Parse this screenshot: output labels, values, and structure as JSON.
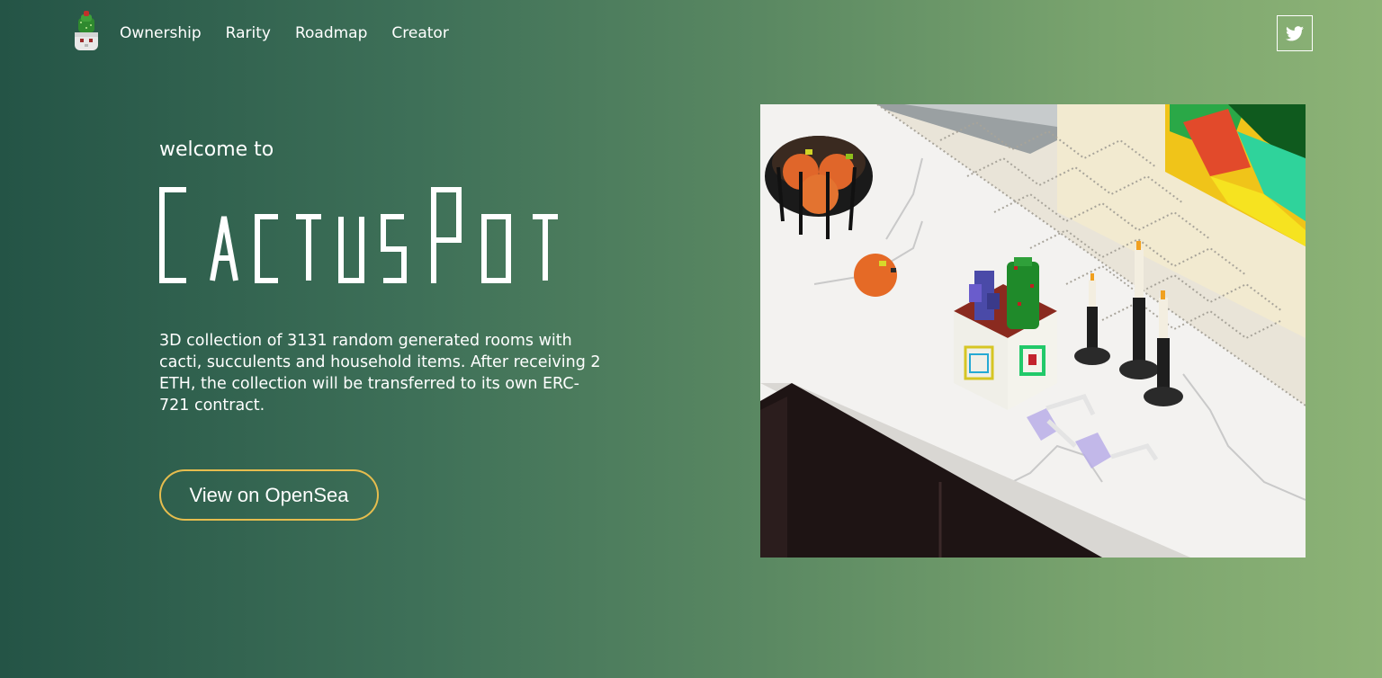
{
  "nav": {
    "logo_icon": "cactus-pot-logo-icon",
    "links": [
      {
        "label": "Ownership"
      },
      {
        "label": "Rarity"
      },
      {
        "label": "Roadmap"
      },
      {
        "label": "Creator"
      }
    ],
    "social_icon": "twitter-icon"
  },
  "hero": {
    "welcome": "welcome to",
    "brand": "CactusPot",
    "description": "3D collection of 3131 random generated rooms with cacti, succulents and household items. After receiving 2 ETH, the collection will be transferred to its own ERC-721 contract.",
    "cta_label": "View on OpenSea",
    "image_icon": "voxel-room-illustration"
  },
  "colors": {
    "gradient_start": "#245446",
    "gradient_end": "#8db376",
    "cta_border": "#e6bd4e",
    "text": "#ffffff"
  }
}
